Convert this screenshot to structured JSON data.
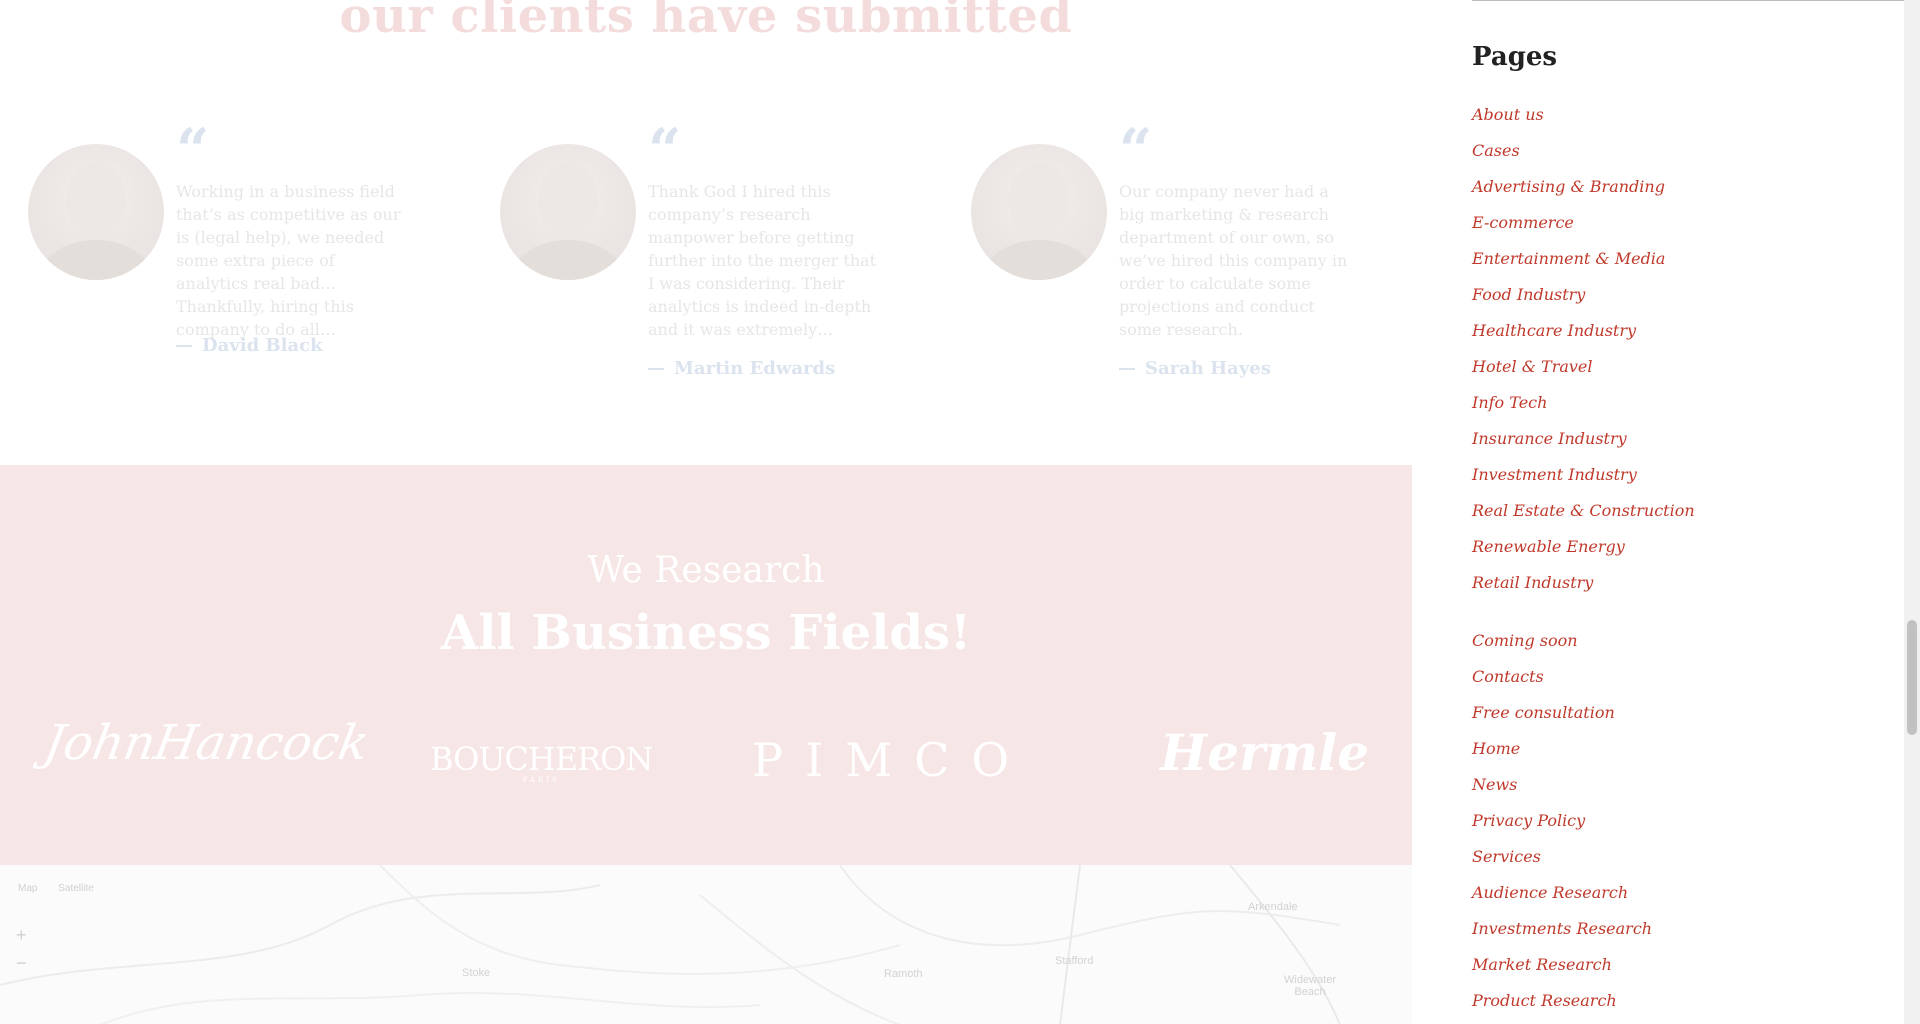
{
  "testimonials_section": {
    "heading": "our clients have submitted",
    "items": [
      {
        "text": "Working in a business field that’s as competitive as our is (legal help), we needed some extra piece of analytics real bad… Thankfully, hiring this company to do all…",
        "author": "David Black"
      },
      {
        "text": "Thank God I hired this company’s research manpower before getting further into the merger that I was considering. Their analytics is indeed in-depth and it was extremely…",
        "author": "Martin Edwards"
      },
      {
        "text": "Our company never had a big marketing & research department of our own, so we’ve hired this company in order to calculate some projections and conduct some research.",
        "author": "Sarah Hayes"
      }
    ]
  },
  "research_section": {
    "subtitle": "We Research",
    "title": "All Business Fields!",
    "logos": {
      "hancock": "JohnHancock",
      "boucheron": "BOUCHERON",
      "boucheron_sub": "PARIS",
      "pimco": "PIMCO",
      "hermle": "Hermle"
    }
  },
  "map": {
    "type_map": "Map",
    "type_satellite": "Satellite",
    "zoom_in": "+",
    "zoom_out": "−",
    "labels": [
      "Stoke",
      "Ramoth",
      "Stafford",
      "Arkendale",
      "Widewater Beach"
    ]
  },
  "sidebar": {
    "title": "Pages",
    "links": [
      "About us",
      "Cases",
      "Advertising & Branding",
      "E-commerce",
      "Entertainment & Media",
      "Food Industry",
      "Healthcare Industry",
      "Hotel & Travel",
      "Info Tech",
      "Insurance Industry",
      "Investment Industry",
      "Real Estate & Construction",
      "Renewable Energy",
      "Retail Industry",
      "Coming soon",
      "Contacts",
      "Free consultation",
      "Home",
      "News",
      "Privacy Policy",
      "Services",
      "Audience Research",
      "Investments Research",
      "Market Research",
      "Product Research"
    ]
  },
  "colors": {
    "link": "#c0392b",
    "research_bg": "#f7e6e6"
  }
}
